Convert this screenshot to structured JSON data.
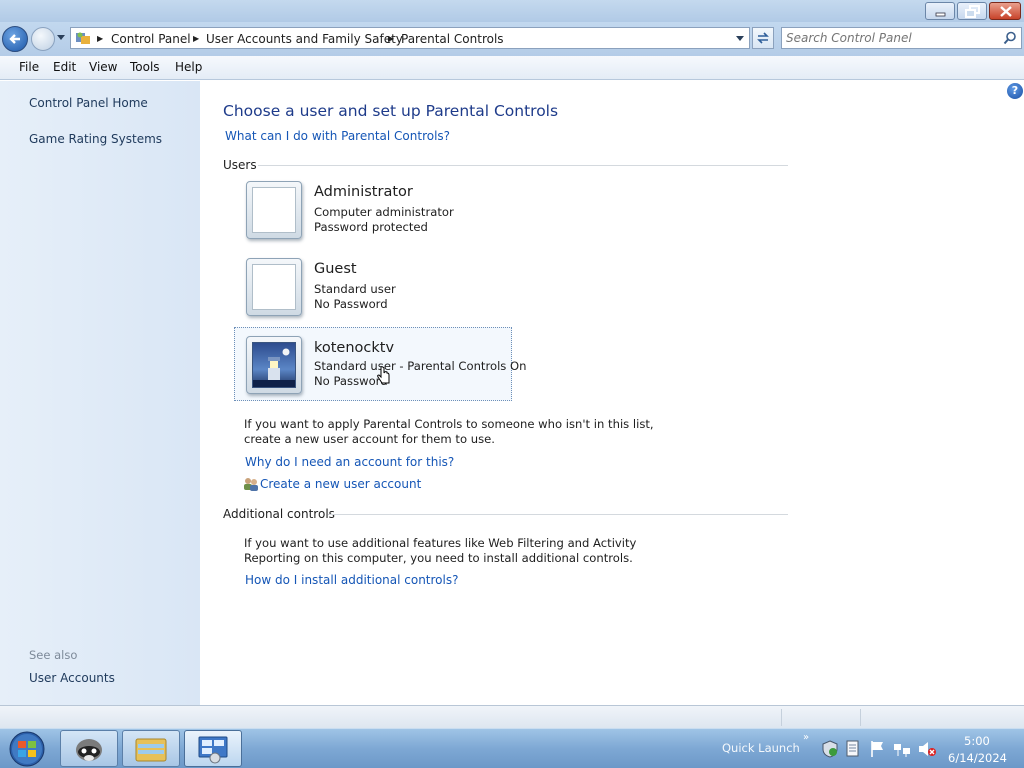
{
  "address_bar": {
    "breadcrumbs": [
      "Control Panel",
      "User Accounts and Family Safety",
      "Parental Controls"
    ],
    "search_placeholder": "Search Control Panel"
  },
  "menu": [
    "File",
    "Edit",
    "View",
    "Tools",
    "Help"
  ],
  "sidebar": {
    "links": [
      "Control Panel Home",
      "Game Rating Systems"
    ],
    "see_also_title": "See also",
    "see_also_links": [
      "User Accounts"
    ]
  },
  "main": {
    "title": "Choose a user and set up Parental Controls",
    "help_link": "What can I do with Parental Controls?",
    "users_heading": "Users",
    "users": [
      {
        "name": "Administrator",
        "type": "Computer administrator",
        "password": "Password protected",
        "picture": "blank"
      },
      {
        "name": "Guest",
        "type": "Standard user",
        "password": "No Password",
        "picture": "blank"
      },
      {
        "name": "kotenocktv",
        "type": "Standard user - Parental Controls On",
        "password": "No Password",
        "picture": "lighthouse",
        "selected": true
      }
    ],
    "no_account_text_line1": "If you want to apply Parental Controls to someone who isn't in this list,",
    "no_account_text_line2": "create a new user account for them to use.",
    "why_link": "Why do I need an account for this?",
    "create_link": "Create a new user account",
    "additional_heading": "Additional controls",
    "additional_text_line1": "If you want to use additional features like Web Filtering and Activity",
    "additional_text_line2": "Reporting on this computer, you need to install additional controls.",
    "install_link": "How do I install additional controls?"
  },
  "taskbar": {
    "quick_launch_label": "Quick Launch",
    "clock_time": "5:00",
    "clock_date": "6/14/2024"
  },
  "colors": {
    "link": "#1556b6",
    "title": "#1e3b8a",
    "sidebar_bg": "#e1ebf7",
    "taskbar": "#7ea8d4"
  }
}
